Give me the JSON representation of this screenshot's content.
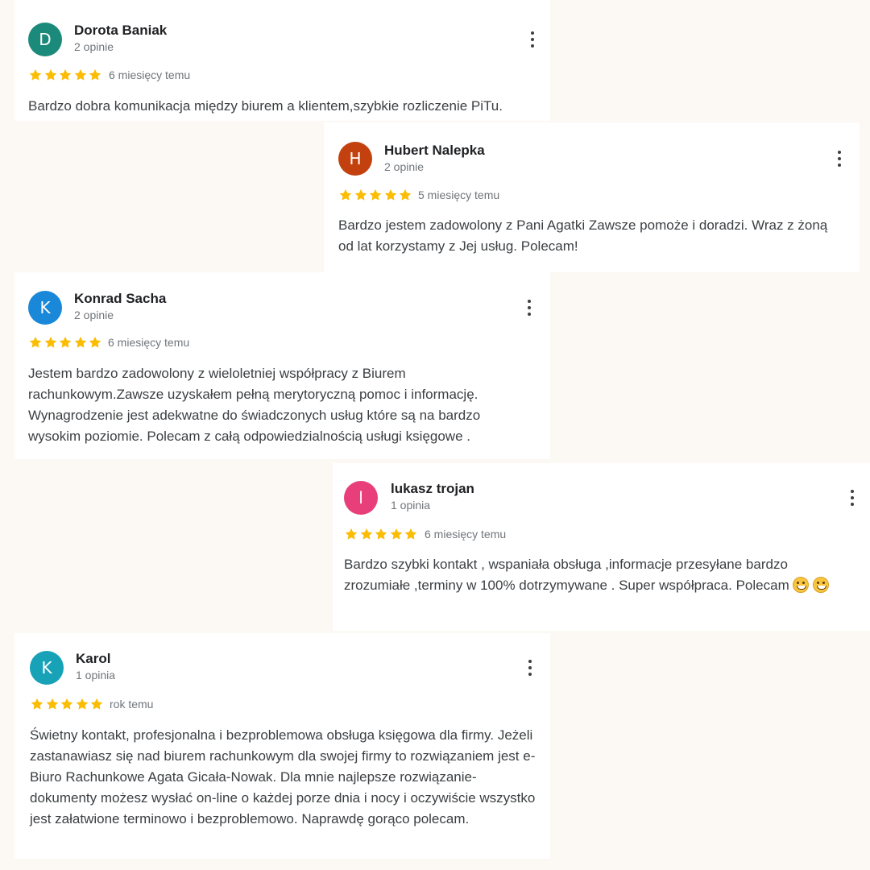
{
  "reviews": [
    {
      "initial": "D",
      "avatar_color": "#1b8a7a",
      "name": "Dorota Baniak",
      "count": "2 opinie",
      "rating": 5,
      "date": "6 miesięcy temu",
      "text": "Bardzo dobra komunikacja między biurem a klientem,szybkie rozliczenie PiTu."
    },
    {
      "initial": "H",
      "avatar_color": "#c2410f",
      "name": "Hubert Nalepka",
      "count": "2 opinie",
      "rating": 5,
      "date": "5 miesięcy temu",
      "text": "Bardzo jestem zadowolony z Pani Agatki Zawsze pomoże i doradzi. Wraz z żoną od lat korzystamy z Jej usług. Polecam!"
    },
    {
      "initial": "K",
      "avatar_color": "#1a88d8",
      "name": "Konrad Sacha",
      "count": "2 opinie",
      "rating": 5,
      "date": "6 miesięcy temu",
      "text": "Jestem bardzo zadowolony z wieloletniej współpracy z Biurem rachunkowym.Zawsze uzyskałem pełną merytoryczną pomoc i informację. Wynagrodzenie jest adekwatne do świadczonych usług które są na bardzo wysokim poziomie. Polecam z całą odpowiedzialnością usługi księgowe ."
    },
    {
      "initial": "l",
      "avatar_color": "#e83f7a",
      "name": "lukasz trojan",
      "count": "1 opinia",
      "rating": 5,
      "date": "6 miesięcy temu",
      "text": "Bardzo szybki kontakt , wspaniała obsługa ,informacje przesyłane bardzo zrozumiałe ,terminy w 100% dotrzymywane . Super współpraca. Polecam",
      "emojis": [
        "grinning-face-emoji",
        "grinning-face-emoji"
      ]
    },
    {
      "initial": "K",
      "avatar_color": "#17a2b8",
      "name": "Karol",
      "count": "1 opinia",
      "rating": 5,
      "date": "rok temu",
      "text": "Świetny kontakt, profesjonalna i bezproblemowa obsługa księgowa dla firmy. Jeżeli zastanawiasz się nad biurem rachunkowym dla swojej firmy to rozwiązaniem jest e-Biuro Rachunkowe Agata Gicała-Nowak. Dla mnie najlepsze rozwiązanie- dokumenty możesz wysłać on-line o każdej porze dnia i nocy i oczywiście wszystko jest załatwione terminowo i bezproblemowo. Naprawdę gorąco polecam."
    }
  ],
  "colors": {
    "star": "#fbbc04",
    "background": "#fcf8f3",
    "card": "#ffffff"
  },
  "icons": {
    "menu": "more-vert-icon",
    "star": "star-icon"
  }
}
